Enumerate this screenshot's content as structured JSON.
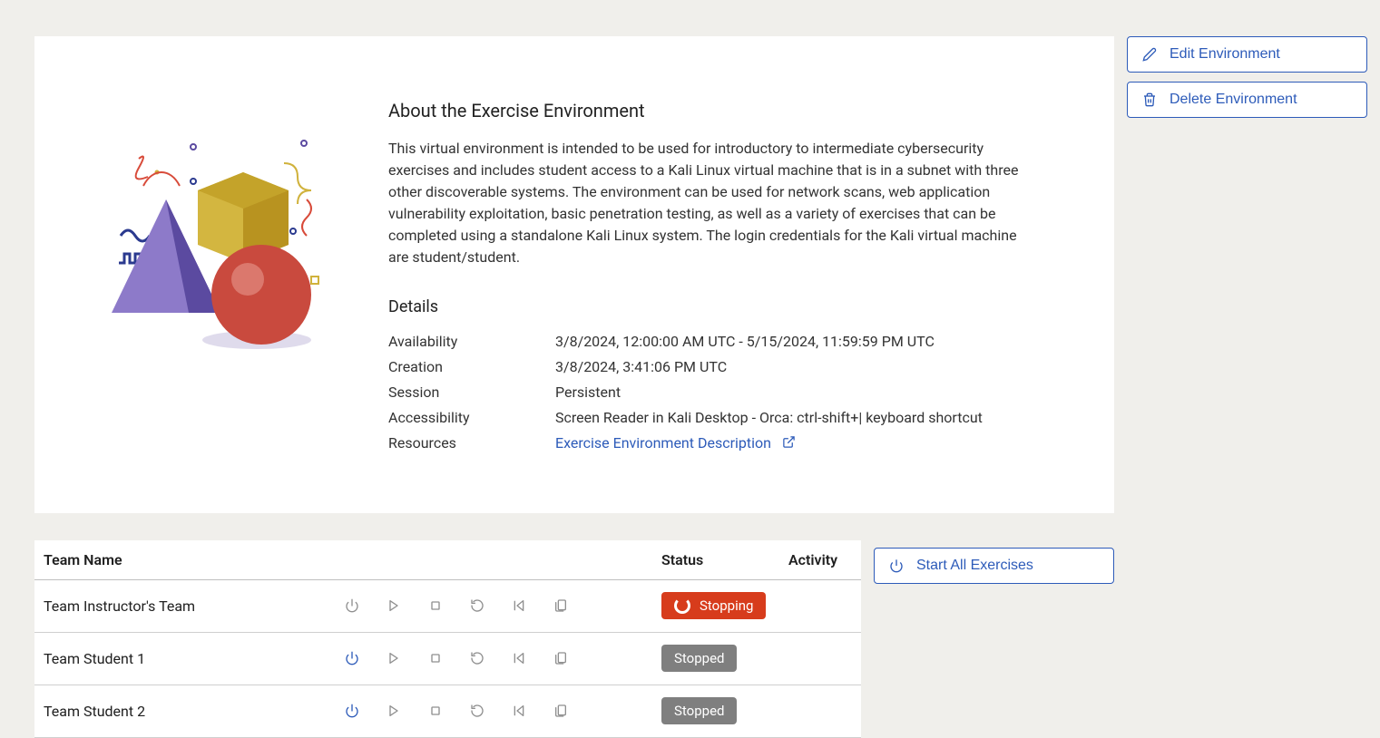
{
  "about": {
    "title": "About the Exercise Environment",
    "description": "This virtual environment is intended to be used for introductory to intermediate cybersecurity exercises and includes student access to a Kali Linux virtual machine that is in a subnet with three other discoverable systems. The environment can be used for network scans, web application vulnerability exploitation, basic penetration testing, as well as a variety of exercises that can be completed using a standalone Kali Linux system. The login credentials for the Kali virtual machine are student/student."
  },
  "details": {
    "heading": "Details",
    "availability_label": "Availability",
    "availability_value": "3/8/2024, 12:00:00 AM UTC - 5/15/2024, 11:59:59 PM UTC",
    "creation_label": "Creation",
    "creation_value": "3/8/2024, 3:41:06 PM UTC",
    "session_label": "Session",
    "session_value": "Persistent",
    "accessibility_label": "Accessibility",
    "accessibility_value": "Screen Reader in Kali Desktop - Orca: ctrl-shift+| keyboard shortcut",
    "resources_label": "Resources",
    "resources_link_text": "Exercise Environment Description"
  },
  "actions": {
    "edit": "Edit Environment",
    "delete": "Delete Environment",
    "start_all": "Start All Exercises"
  },
  "table": {
    "headers": {
      "name": "Team Name",
      "status": "Status",
      "activity": "Activity"
    },
    "rows": [
      {
        "name": "Team Instructor's Team",
        "status": "Stopping",
        "status_type": "stopping",
        "power_active": false
      },
      {
        "name": "Team Student 1",
        "status": "Stopped",
        "status_type": "stopped",
        "power_active": true
      },
      {
        "name": "Team Student 2",
        "status": "Stopped",
        "status_type": "stopped",
        "power_active": true
      }
    ]
  }
}
